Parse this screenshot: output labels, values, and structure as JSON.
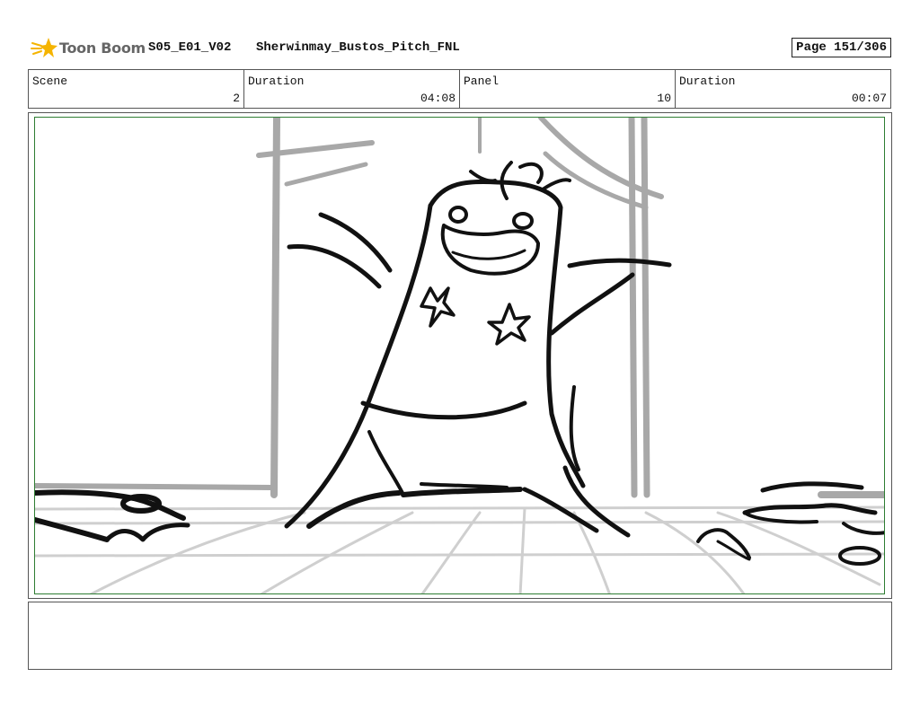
{
  "header": {
    "logo_text": "Toon Boom",
    "code": "S05_E01_V02",
    "name": "Sherwinmay_Bustos_Pitch_FNL",
    "page": "Page 151/306"
  },
  "info": [
    {
      "label": "Scene",
      "value": "2"
    },
    {
      "label": "Duration",
      "value": "04:08"
    },
    {
      "label": "Panel",
      "value": "10"
    },
    {
      "label": "Duration",
      "value": "00:07"
    }
  ],
  "panel": {
    "sketch": "storyboard-sketch-character-arms-raised"
  },
  "notes": {
    "text": ""
  },
  "colors": {
    "frame_border": "#2e7d32",
    "logo_star": "#f5b400",
    "sketch_line": "#111111",
    "background_line": "#a8a8a8"
  }
}
